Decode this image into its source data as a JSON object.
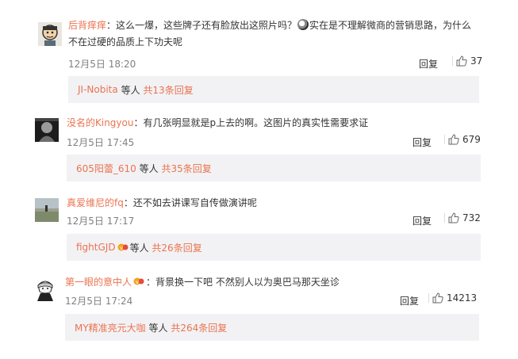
{
  "comments": [
    {
      "user": "后背痒痒",
      "text_before": "：这么一爆，这些牌子还有脸放出这照片吗？",
      "text_after": "实在是不理解微商的营销思路，为什么",
      "text_line2": "不在过硬的品质上下功夫呢",
      "date": "12月5日 18:20",
      "reply_label": "回复",
      "likes": "37",
      "reply_user": "JI-Nobita",
      "reply_mid": "等人",
      "reply_count": "共13条回复"
    },
    {
      "user": "没名的Kingyou",
      "text": "：有几张明显就是p上去的啊。这图片的真实性需要求证",
      "date": "12月5日 17:45",
      "reply_label": "回复",
      "likes": "679",
      "reply_user": "605阳蕾_610",
      "reply_mid": "等人",
      "reply_count": "共35条回复"
    },
    {
      "user": "真爱维尼的fq",
      "text": "：还不如去讲课写自传做演讲呢",
      "date": "12月5日 17:17",
      "reply_label": "回复",
      "likes": "732",
      "reply_user": "fightGJD",
      "reply_mid": "等人",
      "reply_count": "共26条回复"
    },
    {
      "user": "第一眼的意中人",
      "text": "：背景换一下吧  不然别人以为奥巴马那天坐诊",
      "date": "12月5日 17:24",
      "reply_label": "回复",
      "likes": "14213",
      "reply_user": "MY精准亮元大咖",
      "reply_mid": "等人",
      "reply_count": "共264条回复"
    }
  ]
}
